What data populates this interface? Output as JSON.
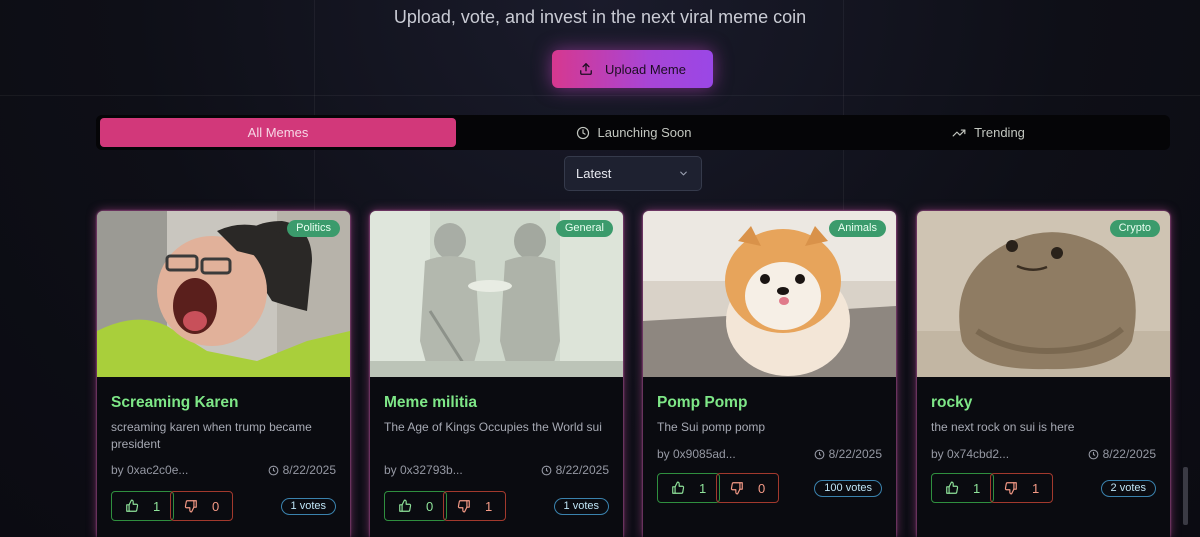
{
  "header": {
    "subtitle": "Upload, vote, and invest in the next viral meme coin",
    "upload_label": "Upload Meme"
  },
  "tabs": [
    {
      "label": "All Memes",
      "active": true,
      "icon": "none"
    },
    {
      "label": "Launching Soon",
      "active": false,
      "icon": "clock-icon"
    },
    {
      "label": "Trending",
      "active": false,
      "icon": "trending-up-icon"
    }
  ],
  "sort": {
    "selected": "Latest"
  },
  "colors": {
    "accent_pink": "#d2387a",
    "title_green": "#7ee787",
    "badge_green": "#3b9b6c",
    "upvote_border": "#2f8f3f",
    "downvote_border": "#a2392d"
  },
  "memes": [
    {
      "title": "Screaming Karen",
      "category": "Politics",
      "description": "screaming karen when trump became president",
      "author": "by 0xac2c0e...",
      "date": "8/22/2025",
      "upvotes": "1",
      "downvotes": "0",
      "total_votes": "1 votes",
      "image": "screaming woman in beanie and glasses"
    },
    {
      "title": "Meme militia",
      "category": "General",
      "description": "The Age of Kings Occupies the World sui",
      "author": "by 0x32793b...",
      "date": "8/22/2025",
      "upvotes": "0",
      "downvotes": "1",
      "total_votes": "1 votes",
      "image": "two armored knights"
    },
    {
      "title": "Pomp Pomp",
      "category": "Animals",
      "description": "The Sui pomp pomp",
      "author": "by 0x9085ad...",
      "date": "8/22/2025",
      "upvotes": "1",
      "downvotes": "0",
      "total_votes": "100 votes",
      "image": "fluffy pomeranian puppy"
    },
    {
      "title": "rocky",
      "category": "Crypto",
      "description": "the next rock on sui is here",
      "author": "by 0x74cbd2...",
      "date": "8/22/2025",
      "upvotes": "1",
      "downvotes": "1",
      "total_votes": "2 votes",
      "image": "rock with a face"
    }
  ]
}
